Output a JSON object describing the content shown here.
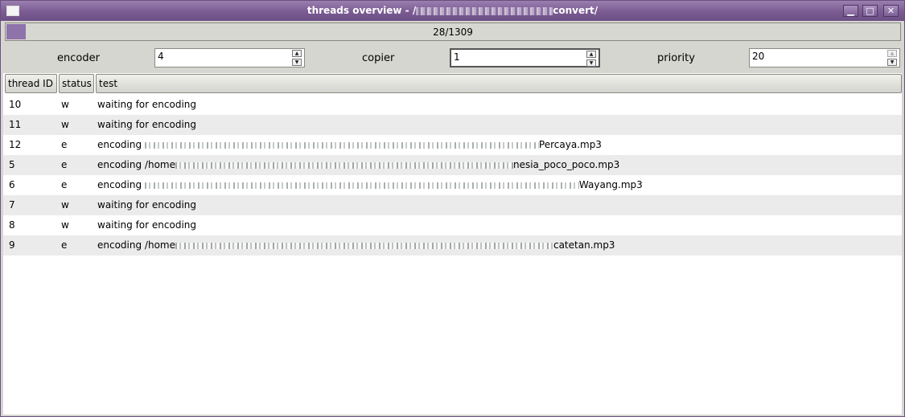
{
  "window": {
    "title_prefix": "threads overview - /",
    "title_suffix": "convert/",
    "buttons": {
      "minimize": "▁",
      "maximize": "□",
      "close": "✕"
    }
  },
  "progress": {
    "text": "28/1309",
    "value": 0.0214,
    "color": "#8e72aa"
  },
  "controls": {
    "encoder": {
      "label": "encoder",
      "value": "4"
    },
    "copier": {
      "label": "copier",
      "value": "1"
    },
    "priority": {
      "label": "priority",
      "value": "20"
    }
  },
  "table": {
    "headers": [
      "thread ID",
      "status",
      "test"
    ],
    "rows": [
      {
        "id": "10",
        "status": "w",
        "text_start": "waiting for encoding",
        "text_end": ""
      },
      {
        "id": "11",
        "status": "w",
        "text_start": "waiting for encoding",
        "text_end": ""
      },
      {
        "id": "12",
        "status": "e",
        "text_start": "encoding ",
        "text_end": "Percaya.mp3"
      },
      {
        "id": "5",
        "status": "e",
        "text_start": "encoding /home",
        "text_end": "nesia_poco_poco.mp3"
      },
      {
        "id": "6",
        "status": "e",
        "text_start": "encoding ",
        "text_end": "Wayang.mp3"
      },
      {
        "id": "7",
        "status": "w",
        "text_start": "waiting for encoding",
        "text_end": ""
      },
      {
        "id": "8",
        "status": "w",
        "text_start": "waiting for encoding",
        "text_end": ""
      },
      {
        "id": "9",
        "status": "e",
        "text_start": "encoding /home",
        "text_end": "catetan.mp3"
      }
    ]
  },
  "theme": {
    "accent": "#7a5b92",
    "row_alt": "#ebebeb"
  }
}
